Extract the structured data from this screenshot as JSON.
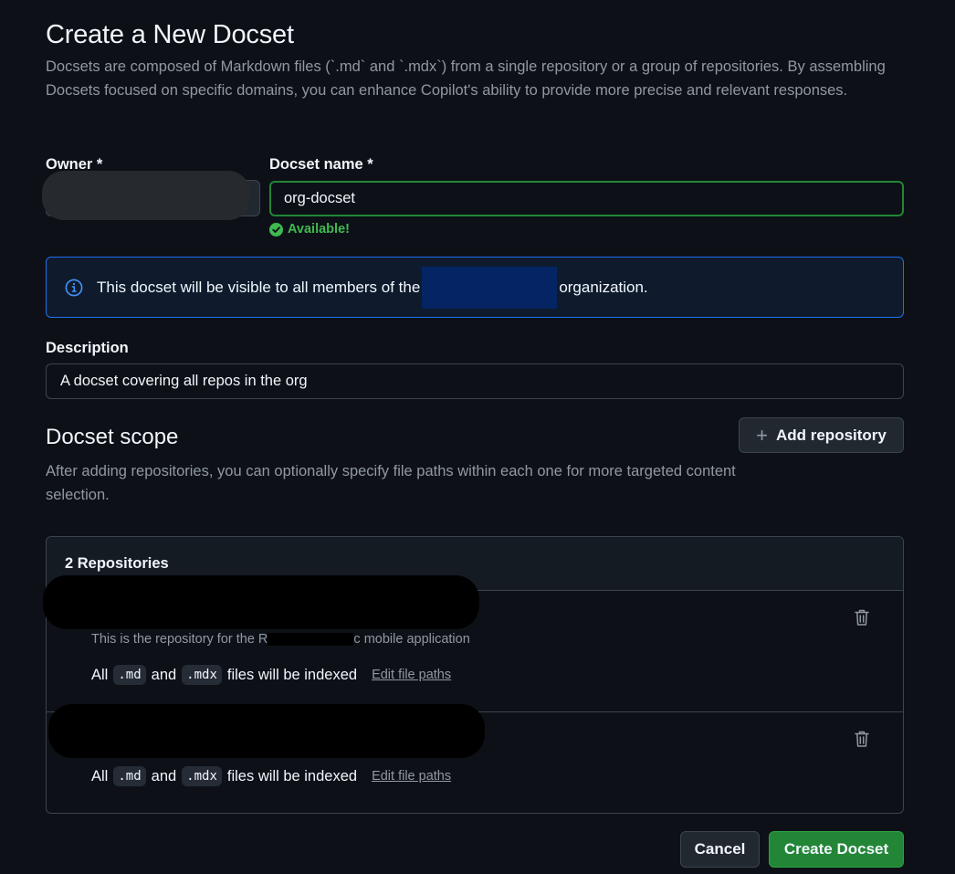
{
  "header": {
    "title": "Create a New Docset",
    "description": "Docsets are composed of Markdown files (`.md` and `.mdx`) from a single repository or a group of repositories. By assembling Docsets focused on specific domains, you can enhance Copilot's ability to provide more precise and relevant responses."
  },
  "form": {
    "owner_label": "Owner *",
    "name_label": "Docset name *",
    "name_value": "org-docset",
    "available_text": "Available!",
    "visibility_before": "This docset will be visible to all members of the",
    "visibility_after": "organization.",
    "description_label": "Description",
    "description_value": "A docset covering all repos in the org"
  },
  "scope": {
    "title": "Docset scope",
    "description": "After adding repositories, you can optionally specify file paths within each one for more targeted content selection.",
    "add_button": "Add repository",
    "repo_count_label": "2 Repositories",
    "repositories": [
      {
        "description_start": "This is the repository for the R",
        "description_end": "c mobile application",
        "indexed_all": "All",
        "indexed_ext1": ".md",
        "indexed_and": "and",
        "indexed_ext2": ".mdx",
        "indexed_tail": "files will be indexed",
        "edit_link": "Edit file paths"
      },
      {
        "indexed_all": "All",
        "indexed_ext1": ".md",
        "indexed_and": "and",
        "indexed_ext2": ".mdx",
        "indexed_tail": "files will be indexed",
        "edit_link": "Edit file paths"
      }
    ]
  },
  "footer": {
    "cancel": "Cancel",
    "create": "Create Docset"
  },
  "colors": {
    "background": "#0d1117",
    "success": "#3fb950",
    "accent_info": "#1f6feb",
    "primary_button": "#238636"
  }
}
